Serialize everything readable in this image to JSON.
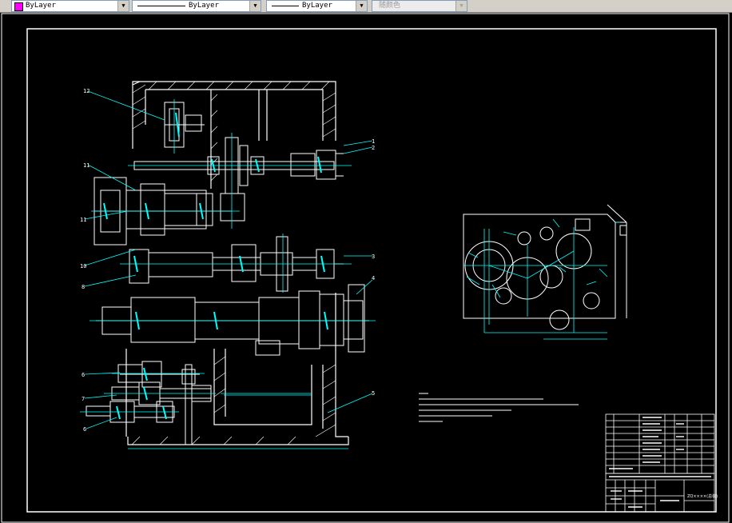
{
  "toolbar": {
    "color_combo": {
      "value": "ByLayer",
      "swatch_color": "#ff00ff"
    },
    "linetype_combo": {
      "value": "ByLayer"
    },
    "lineweight_combo": {
      "value": "ByLayer"
    },
    "plotstyle_combo": {
      "value": "随颜色",
      "enabled": false
    }
  },
  "drawing": {
    "balloons_left": [
      "12",
      "11",
      "11",
      "10",
      "8",
      "6",
      "7",
      "6"
    ],
    "balloons_right": [
      "1",
      "2",
      "3",
      "4",
      "5"
    ],
    "title_block_name": "ZQ××××(总装)"
  },
  "colors": {
    "background": "#000000",
    "drawing_lines": "#ffffff",
    "center_lines": "#00ffff",
    "dimension_lines": "#00ffff"
  }
}
